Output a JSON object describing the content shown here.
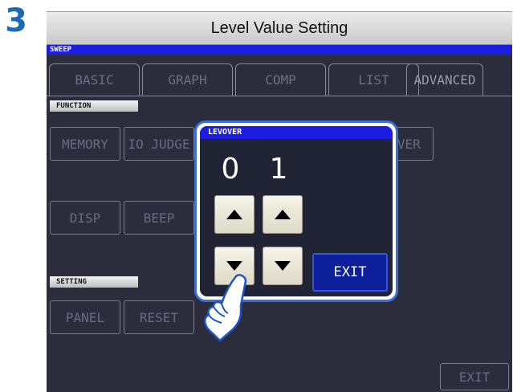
{
  "step_number": "3",
  "page_title": "Level Value Setting",
  "screen_header": "SWEEP",
  "tabs": [
    {
      "label": "BASIC"
    },
    {
      "label": "GRAPH"
    },
    {
      "label": "COMP"
    },
    {
      "label": "LIST"
    },
    {
      "label": "ADVANCED"
    }
  ],
  "function_section": {
    "label": "FUNCTION",
    "buttons": [
      {
        "label": "MEMORY"
      },
      {
        "label": "IO JUDGE"
      },
      {
        "label": "LEVOVER"
      },
      {
        "label": "DISP"
      },
      {
        "label": "BEEP"
      }
    ]
  },
  "setting_section": {
    "label": "SETTING",
    "buttons": [
      {
        "label": "PANEL"
      },
      {
        "label": "RESET"
      }
    ]
  },
  "exit_label": "EXIT",
  "dialog": {
    "title": "LEVOVER",
    "digits": [
      "0",
      "1"
    ],
    "exit_label": "EXIT"
  },
  "icons": {
    "up": "up-arrow-icon",
    "down": "down-arrow-icon",
    "hand": "pointing-hand-icon"
  },
  "colors": {
    "step_number": "#1a6ab8",
    "header_bar": "#1b1ee0",
    "screen_bg": "#2c2d3c",
    "dialog_border": "#3b6fd6",
    "exit_button": "#0d1f9a"
  }
}
